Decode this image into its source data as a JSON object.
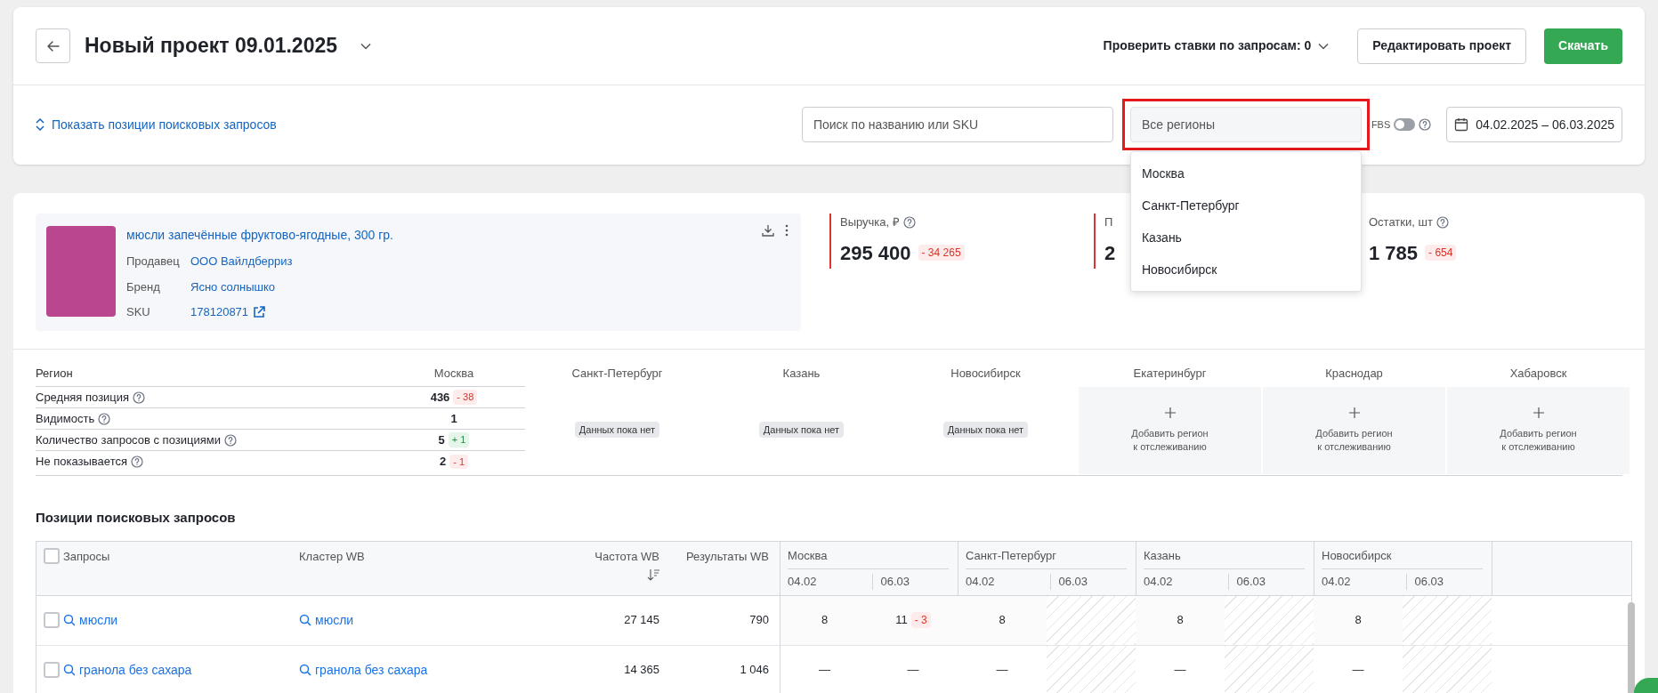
{
  "header": {
    "title": "Новый проект 09.01.2025",
    "bids_check": "Проверить ставки по запросам: 0",
    "edit_button": "Редактировать проект",
    "download_button": "Скачать"
  },
  "toolbar": {
    "toggle_link": "Показать позиции поисковых запросов",
    "search": {
      "placeholder": "Поиск по названию или SKU"
    },
    "region_select": {
      "placeholder": "Все регионы",
      "expanded": true,
      "highlighted": true,
      "options": [
        "Москва",
        "Санкт-Петербург",
        "Казань",
        "Новосибирск"
      ]
    },
    "fbs": {
      "label": "FBS",
      "on": false
    },
    "date_range": "04.02.2025 – 06.03.2025"
  },
  "product": {
    "name": "мюсли запечённые фруктово-ягодные, 300 гр.",
    "fields": [
      {
        "label": "Продавец",
        "value": "ООО Вайлдберриз",
        "external_link": false
      },
      {
        "label": "Бренд",
        "value": "Ясно солнышко",
        "external_link": false
      },
      {
        "label": "SKU",
        "value": "178120871",
        "external_link": true
      }
    ]
  },
  "metrics": [
    {
      "label": "Выручка, ₽",
      "help": true,
      "value": "295 400",
      "delta": {
        "text": "- 34 265",
        "kind": "negative"
      }
    },
    {
      "label": "П",
      "help": false,
      "value": "2"
    },
    {
      "label": "Остатки, шт",
      "help": true,
      "value": "1 785",
      "delta": {
        "text": "- 654",
        "kind": "negative"
      }
    }
  ],
  "regions_table": {
    "header": "Регион",
    "tracked": [
      {
        "name": "Москва",
        "has_data": true
      },
      {
        "name": "Санкт-Петербург",
        "has_data": false,
        "no_data": "Данных пока нет"
      },
      {
        "name": "Казань",
        "has_data": false,
        "no_data": "Данных пока нет"
      },
      {
        "name": "Новосибирск",
        "has_data": false,
        "no_data": "Данных пока нет"
      }
    ],
    "untracked": [
      {
        "name": "Екатеринбург",
        "add_label": "Добавить регион\nк отслеживанию"
      },
      {
        "name": "Краснодар",
        "add_label": "Добавить регион\nк отслеживанию"
      },
      {
        "name": "Хабаровск",
        "add_label": "Добавить регион\nк отслеживанию"
      }
    ],
    "rows": [
      {
        "label": "Средняя позиция",
        "help": true,
        "value": "436",
        "delta": {
          "text": "- 38",
          "kind": "negative"
        }
      },
      {
        "label": "Видимость",
        "help": true,
        "value": "1"
      },
      {
        "label": "Количество запросов с позициями",
        "help": true,
        "value": "5",
        "delta": {
          "text": "+ 1",
          "kind": "positive"
        }
      },
      {
        "label": "Не показывается",
        "help": true,
        "value": "2",
        "delta": {
          "text": "- 1",
          "kind": "negative"
        }
      }
    ]
  },
  "queries": {
    "title": "Позиции поисковых запросов",
    "columns": [
      "Запросы",
      "Кластер WB",
      "Частота WB",
      "Результаты WB"
    ],
    "all_checked": false,
    "regions": [
      {
        "name": "Москва",
        "dates": [
          "04.02",
          "06.03"
        ]
      },
      {
        "name": "Санкт-Петербург",
        "dates": [
          "04.02",
          "06.03"
        ]
      },
      {
        "name": "Казань",
        "dates": [
          "04.02",
          "06.03"
        ]
      },
      {
        "name": "Новосибирск",
        "dates": [
          "04.02",
          "06.03"
        ]
      }
    ],
    "rows": [
      {
        "checked": false,
        "query": "мюсли",
        "cluster": "мюсли",
        "frequency": "27 145",
        "results": "790",
        "cells": [
          {
            "hatched": false,
            "value": "8"
          },
          {
            "hatched": false,
            "value": "11",
            "delta": {
              "text": "- 3",
              "kind": "negative"
            }
          },
          {
            "hatched": false,
            "value": "8"
          },
          {
            "hatched": true
          },
          {
            "hatched": false,
            "value": "8"
          },
          {
            "hatched": true
          },
          {
            "hatched": false,
            "value": "8"
          },
          {
            "hatched": true
          }
        ]
      },
      {
        "checked": false,
        "query": "гранола без сахара",
        "cluster": "гранола без сахара",
        "frequency": "14 365",
        "results": "1 046",
        "cells": [
          {
            "hatched": false,
            "value": "—"
          },
          {
            "hatched": false,
            "value": "—"
          },
          {
            "hatched": false,
            "value": "—"
          },
          {
            "hatched": true
          },
          {
            "hatched": false,
            "value": "—"
          },
          {
            "hatched": true
          },
          {
            "hatched": false,
            "value": "—"
          },
          {
            "hatched": true
          }
        ]
      }
    ]
  }
}
